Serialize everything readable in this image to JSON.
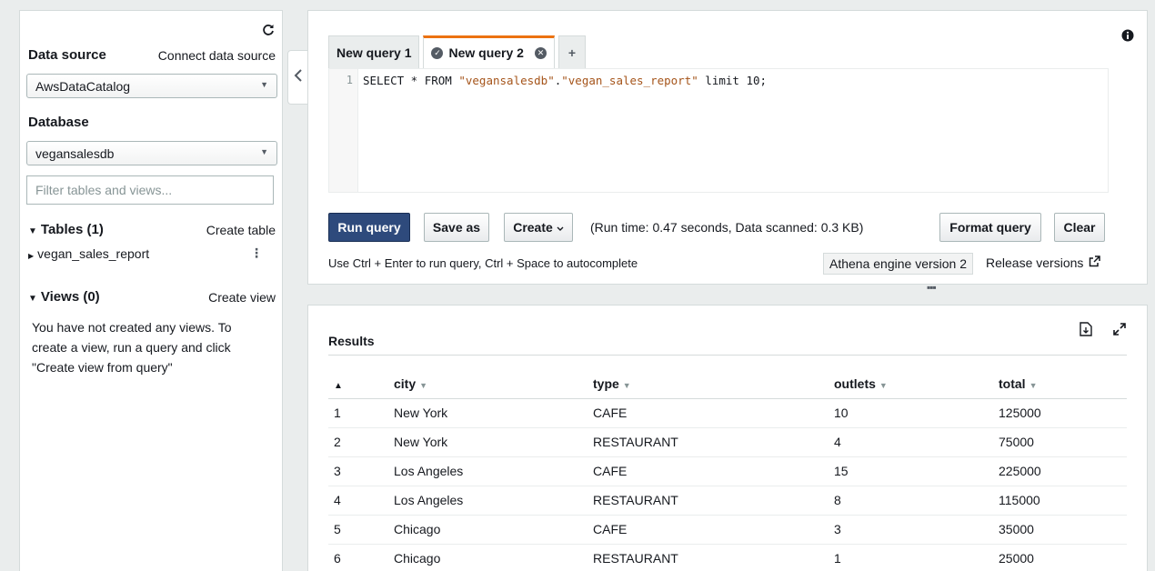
{
  "sidebar": {
    "data_source_label": "Data source",
    "connect_link": "Connect data source",
    "data_source_value": "AwsDataCatalog",
    "database_label": "Database",
    "database_value": "vegansalesdb",
    "filter_placeholder": "Filter tables and views...",
    "tables_label": "Tables (1)",
    "create_table_link": "Create table",
    "table_name": "vegan_sales_report",
    "views_label": "Views (0)",
    "create_view_link": "Create view",
    "views_empty_text": "You have not created any views. To create a view, run a query and click \"Create view from query\""
  },
  "editor": {
    "tabs": [
      {
        "label": "New query 1"
      },
      {
        "label": "New query 2"
      }
    ],
    "add_tab_symbol": "+",
    "line_number": "1",
    "code": {
      "prefix": "SELECT * FROM ",
      "db": "\"vegansalesdb\"",
      "dot": ".",
      "table": "\"vegan_sales_report\"",
      "suffix": " limit 10;"
    },
    "run_button": "Run query",
    "save_button": "Save as",
    "create_button": "Create",
    "run_status": "(Run time: 0.47 seconds, Data scanned: 0.3 KB)",
    "format_button": "Format query",
    "clear_button": "Clear",
    "shortcut_help": "Use Ctrl + Enter to run query, Ctrl + Space to autocomplete",
    "engine_badge": "Athena engine version 2",
    "release_link": "Release versions"
  },
  "results": {
    "title": "Results",
    "columns": [
      "city",
      "type",
      "outlets",
      "total"
    ],
    "rows": [
      [
        "1",
        "New York",
        "CAFE",
        "10",
        "125000"
      ],
      [
        "2",
        "New York",
        "RESTAURANT",
        "4",
        "75000"
      ],
      [
        "3",
        "Los Angeles",
        "CAFE",
        "15",
        "225000"
      ],
      [
        "4",
        "Los Angeles",
        "RESTAURANT",
        "8",
        "115000"
      ],
      [
        "5",
        "Chicago",
        "CAFE",
        "3",
        "35000"
      ],
      [
        "6",
        "Chicago",
        "RESTAURANT",
        "1",
        "25000"
      ]
    ]
  },
  "colors": {
    "accent_tab": "#ec7211",
    "primary_button": "#2e4a7c",
    "string_literal": "#a5541a",
    "background": "#eaeded"
  },
  "icons": [
    "refresh-icon",
    "info-icon",
    "chevron-left-icon",
    "check-circle-icon",
    "close-circle-icon",
    "external-link-icon",
    "download-icon",
    "expand-icon"
  ]
}
